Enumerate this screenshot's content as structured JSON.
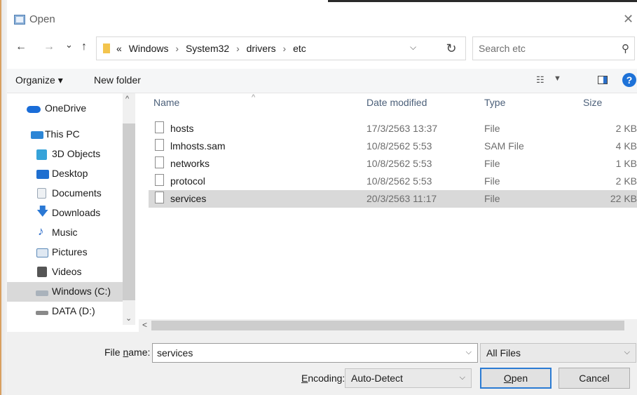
{
  "window": {
    "title": "Open"
  },
  "nav": {
    "back": "←",
    "forward": "→",
    "recent": "⌄",
    "up": "↑",
    "address_prefix": "«",
    "path": [
      "Windows",
      "System32",
      "drivers",
      "etc"
    ],
    "separator": "›",
    "search_placeholder": "Search etc",
    "refresh": "↻"
  },
  "toolbar": {
    "organize": "Organize ▾",
    "new_folder": "New folder"
  },
  "sidebar": {
    "items": [
      {
        "label": "OneDrive",
        "icon": "cloud-icon",
        "color": "#1a6dd8"
      },
      {
        "label": "This PC",
        "icon": "computer-icon",
        "color": "#2d86d6"
      },
      {
        "label": "3D Objects",
        "icon": "cube-icon",
        "color": "#36a3d9"
      },
      {
        "label": "Desktop",
        "icon": "desktop-icon",
        "color": "#1f6fd0"
      },
      {
        "label": "Documents",
        "icon": "document-icon",
        "color": "#9aa7b5"
      },
      {
        "label": "Downloads",
        "icon": "download-icon",
        "color": "#2a78d4"
      },
      {
        "label": "Music",
        "icon": "music-icon",
        "color": "#2b6ccb"
      },
      {
        "label": "Pictures",
        "icon": "picture-icon",
        "color": "#5b89b8"
      },
      {
        "label": "Videos",
        "icon": "video-icon",
        "color": "#555555"
      },
      {
        "label": "Windows (C:)",
        "icon": "drive-windows-icon",
        "color": "#2d86d6"
      },
      {
        "label": "DATA (D:)",
        "icon": "drive-icon",
        "color": "#8a8a8a"
      }
    ],
    "selected": "Windows (C:)"
  },
  "columns": [
    "Name",
    "Date modified",
    "Type",
    "Size"
  ],
  "files": [
    {
      "name": "hosts",
      "date": "17/3/2563 13:37",
      "type": "File",
      "size": "2 KB"
    },
    {
      "name": "lmhosts.sam",
      "date": "10/8/2562 5:53",
      "type": "SAM File",
      "size": "4 KB"
    },
    {
      "name": "networks",
      "date": "10/8/2562 5:53",
      "type": "File",
      "size": "1 KB"
    },
    {
      "name": "protocol",
      "date": "10/8/2562 5:53",
      "type": "File",
      "size": "2 KB"
    },
    {
      "name": "services",
      "date": "20/3/2563 11:17",
      "type": "File",
      "size": "22 KB"
    }
  ],
  "selected_file": "services",
  "bottom": {
    "file_name_label_pre": "File ",
    "file_name_label_u": "n",
    "file_name_label_post": "ame:",
    "file_name_value": "services",
    "filter": "All Files",
    "encoding_label_u": "E",
    "encoding_label_post": "ncoding:",
    "encoding_value": "Auto-Detect",
    "open_u": "O",
    "open_post": "pen",
    "cancel": "Cancel"
  },
  "colors": {
    "accent": "#2b7bd3",
    "help": "#1e72d8",
    "selection": "#d9d9d9"
  }
}
